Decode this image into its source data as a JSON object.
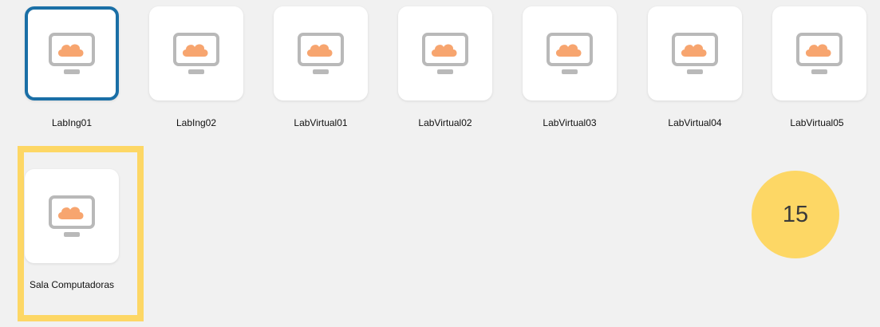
{
  "hosts": [
    {
      "name": "LabIng01",
      "selected": true
    },
    {
      "name": "LabIng02",
      "selected": false
    },
    {
      "name": "LabVirtual01",
      "selected": false
    },
    {
      "name": "LabVirtual02",
      "selected": false
    },
    {
      "name": "LabVirtual03",
      "selected": false
    },
    {
      "name": "LabVirtual04",
      "selected": false
    },
    {
      "name": "LabVirtual05",
      "selected": false
    },
    {
      "name": "Sala Computadoras",
      "selected": false
    }
  ],
  "icon_name": "cloud-monitor-icon",
  "highlight_color": "#fdd765",
  "selection_color": "#1a6fa6",
  "badge": {
    "text": "15"
  }
}
